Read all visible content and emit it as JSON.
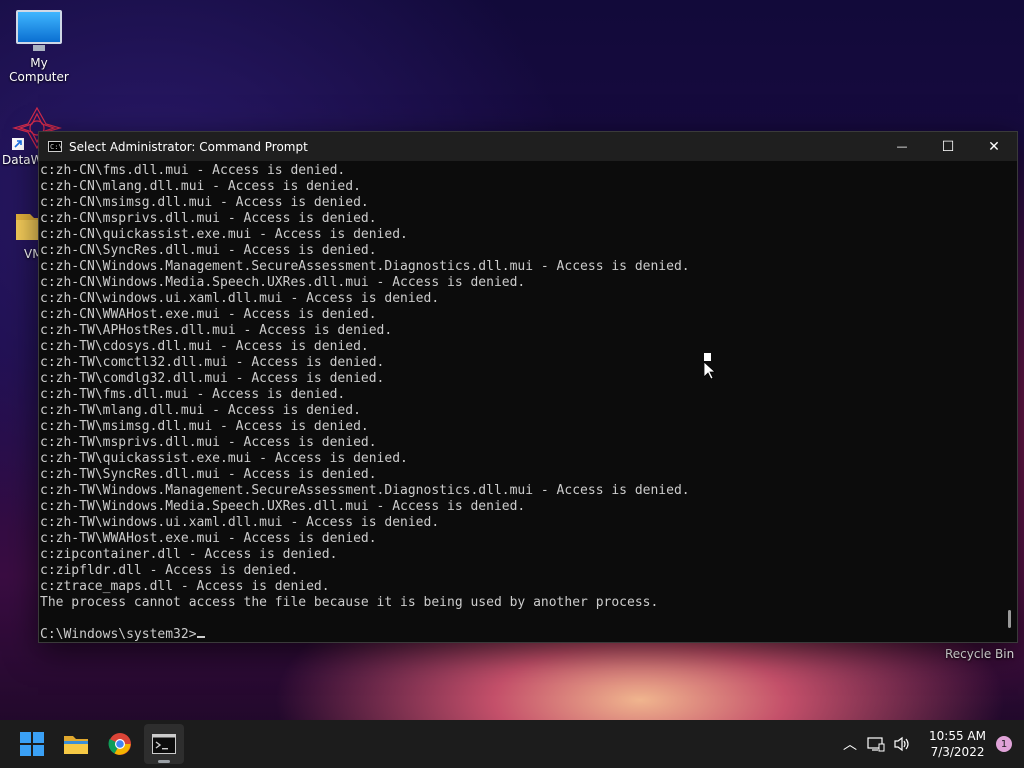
{
  "desktop": {
    "icons": [
      {
        "label": "My Computer",
        "icon": "monitor-icon"
      },
      {
        "label": "DataW",
        "icon": "datawrapper-icon"
      },
      {
        "label": "VM",
        "icon": "folder-icon"
      }
    ],
    "recycle_bin": "Recycle Bin"
  },
  "window": {
    "title": "Select Administrator: Command Prompt",
    "controls": {
      "minimize": "—",
      "maximize": "☐",
      "close": "✕"
    },
    "lines": [
      "c:zh-CN\\fms.dll.mui - Access is denied.",
      "c:zh-CN\\mlang.dll.mui - Access is denied.",
      "c:zh-CN\\msimsg.dll.mui - Access is denied.",
      "c:zh-CN\\msprivs.dll.mui - Access is denied.",
      "c:zh-CN\\quickassist.exe.mui - Access is denied.",
      "c:zh-CN\\SyncRes.dll.mui - Access is denied.",
      "c:zh-CN\\Windows.Management.SecureAssessment.Diagnostics.dll.mui - Access is denied.",
      "c:zh-CN\\Windows.Media.Speech.UXRes.dll.mui - Access is denied.",
      "c:zh-CN\\windows.ui.xaml.dll.mui - Access is denied.",
      "c:zh-CN\\WWAHost.exe.mui - Access is denied.",
      "c:zh-TW\\APHostRes.dll.mui - Access is denied.",
      "c:zh-TW\\cdosys.dll.mui - Access is denied.",
      "c:zh-TW\\comctl32.dll.mui - Access is denied.",
      "c:zh-TW\\comdlg32.dll.mui - Access is denied.",
      "c:zh-TW\\fms.dll.mui - Access is denied.",
      "c:zh-TW\\mlang.dll.mui - Access is denied.",
      "c:zh-TW\\msimsg.dll.mui - Access is denied.",
      "c:zh-TW\\msprivs.dll.mui - Access is denied.",
      "c:zh-TW\\quickassist.exe.mui - Access is denied.",
      "c:zh-TW\\SyncRes.dll.mui - Access is denied.",
      "c:zh-TW\\Windows.Management.SecureAssessment.Diagnostics.dll.mui - Access is denied.",
      "c:zh-TW\\Windows.Media.Speech.UXRes.dll.mui - Access is denied.",
      "c:zh-TW\\windows.ui.xaml.dll.mui - Access is denied.",
      "c:zh-TW\\WWAHost.exe.mui - Access is denied.",
      "c:zipcontainer.dll - Access is denied.",
      "c:zipfldr.dll - Access is denied.",
      "c:ztrace_maps.dll - Access is denied.",
      "The process cannot access the file because it is being used by another process.",
      ""
    ],
    "prompt": "C:\\Windows\\system32>"
  },
  "taskbar": {
    "apps": [
      {
        "name": "start",
        "icon": "windows-start-icon"
      },
      {
        "name": "file-explorer",
        "icon": "folder-icon"
      },
      {
        "name": "chrome",
        "icon": "chrome-icon"
      },
      {
        "name": "command-prompt",
        "icon": "cmd-icon",
        "active": true
      }
    ],
    "time": "10:55 AM",
    "date": "7/3/2022",
    "notification_count": "1"
  }
}
